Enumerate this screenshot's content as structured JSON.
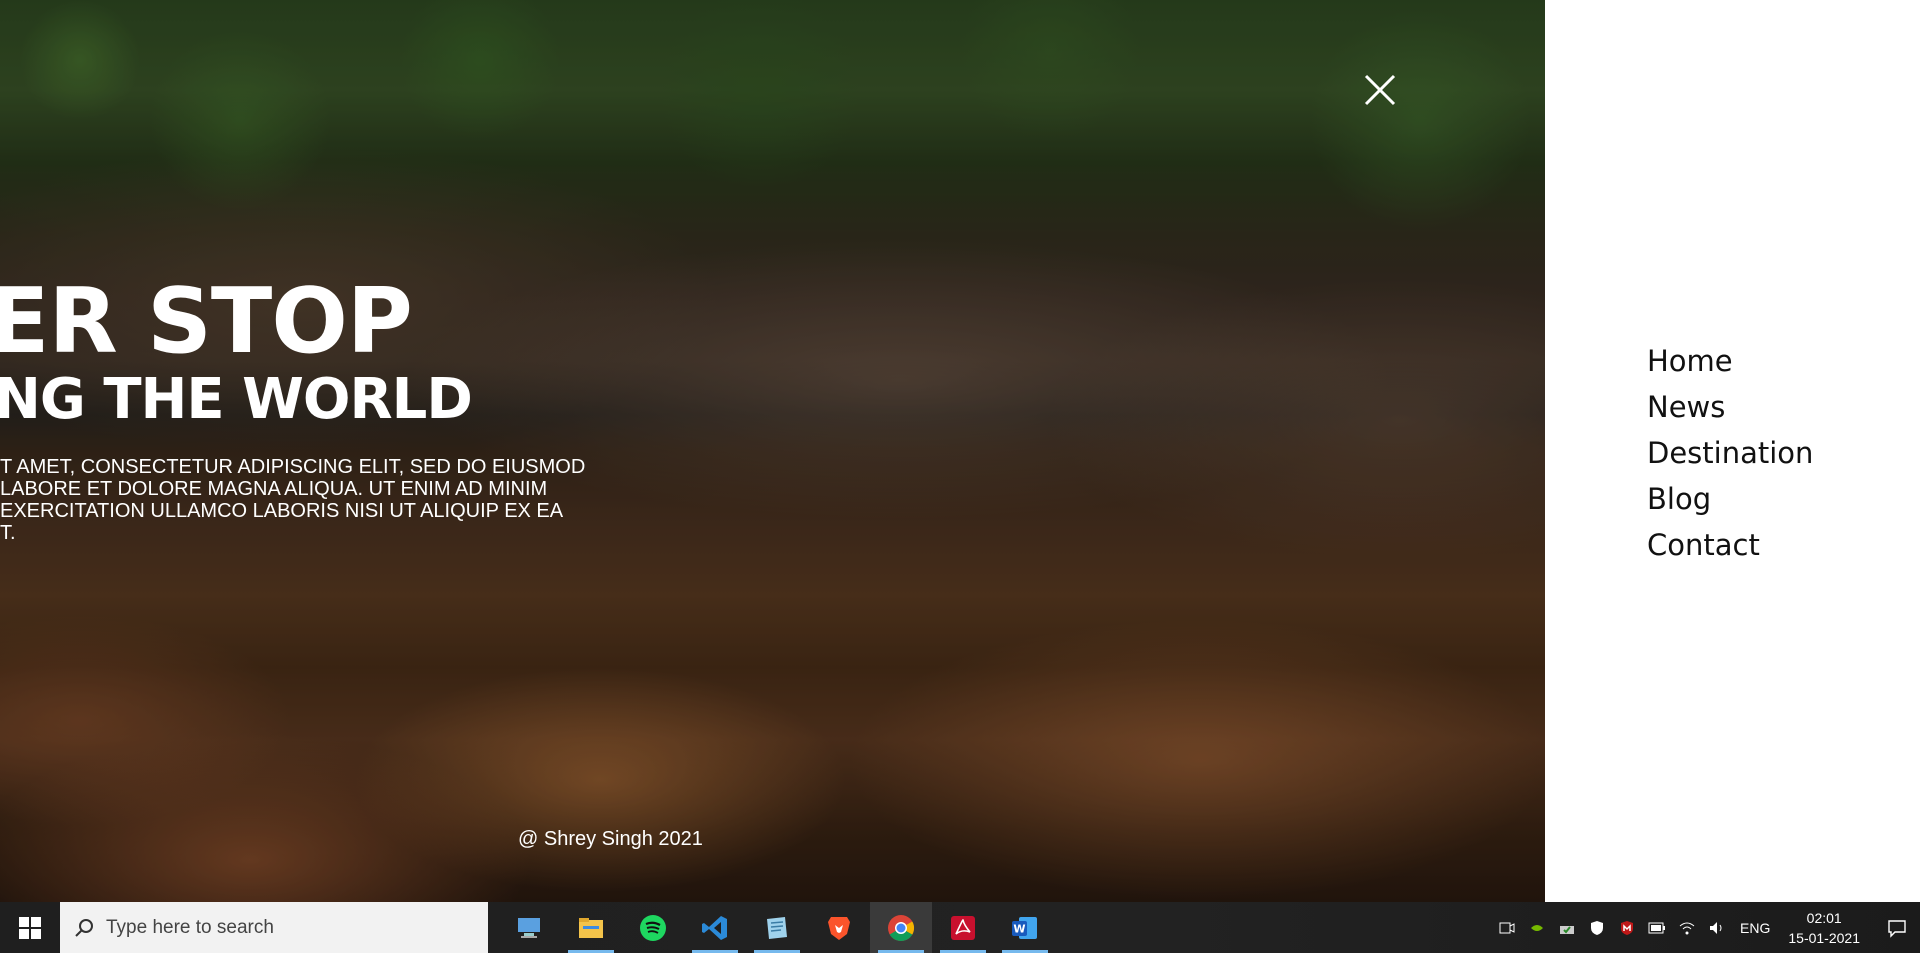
{
  "hero": {
    "headline_line1": "ER STOP",
    "headline_line2": "NG THE WORLD",
    "paragraph_lines": [
      "T AMET, CONSECTETUR ADIPISCING ELIT, SED DO EIUSMOD",
      "LABORE ET DOLORE MAGNA ALIQUA. UT ENIM AD MINIM",
      "EXERCITATION ULLAMCO LABORIS NISI UT ALIQUIP EX EA",
      "T."
    ],
    "credit": "@ Shrey Singh 2021"
  },
  "nav": {
    "items": [
      {
        "label": "Home"
      },
      {
        "label": "News"
      },
      {
        "label": "Destination"
      },
      {
        "label": "Blog"
      },
      {
        "label": "Contact"
      }
    ]
  },
  "taskbar": {
    "search_placeholder": "Type here to search",
    "apps": [
      {
        "icon": "remote-desktop-icon"
      },
      {
        "icon": "file-explorer-icon"
      },
      {
        "icon": "spotify-icon"
      },
      {
        "icon": "vscode-icon"
      },
      {
        "icon": "notepad-icon"
      },
      {
        "icon": "brave-icon"
      },
      {
        "icon": "chrome-icon",
        "active": true
      },
      {
        "icon": "acrobat-icon"
      },
      {
        "icon": "word-icon"
      }
    ],
    "language": "ENG",
    "time": "02:01",
    "date": "15-01-2021"
  },
  "colors": {
    "panel_bg": "#ffffff",
    "nav_text": "#111111",
    "taskbar_bg": "#202020",
    "accent": "#76b9ed"
  }
}
